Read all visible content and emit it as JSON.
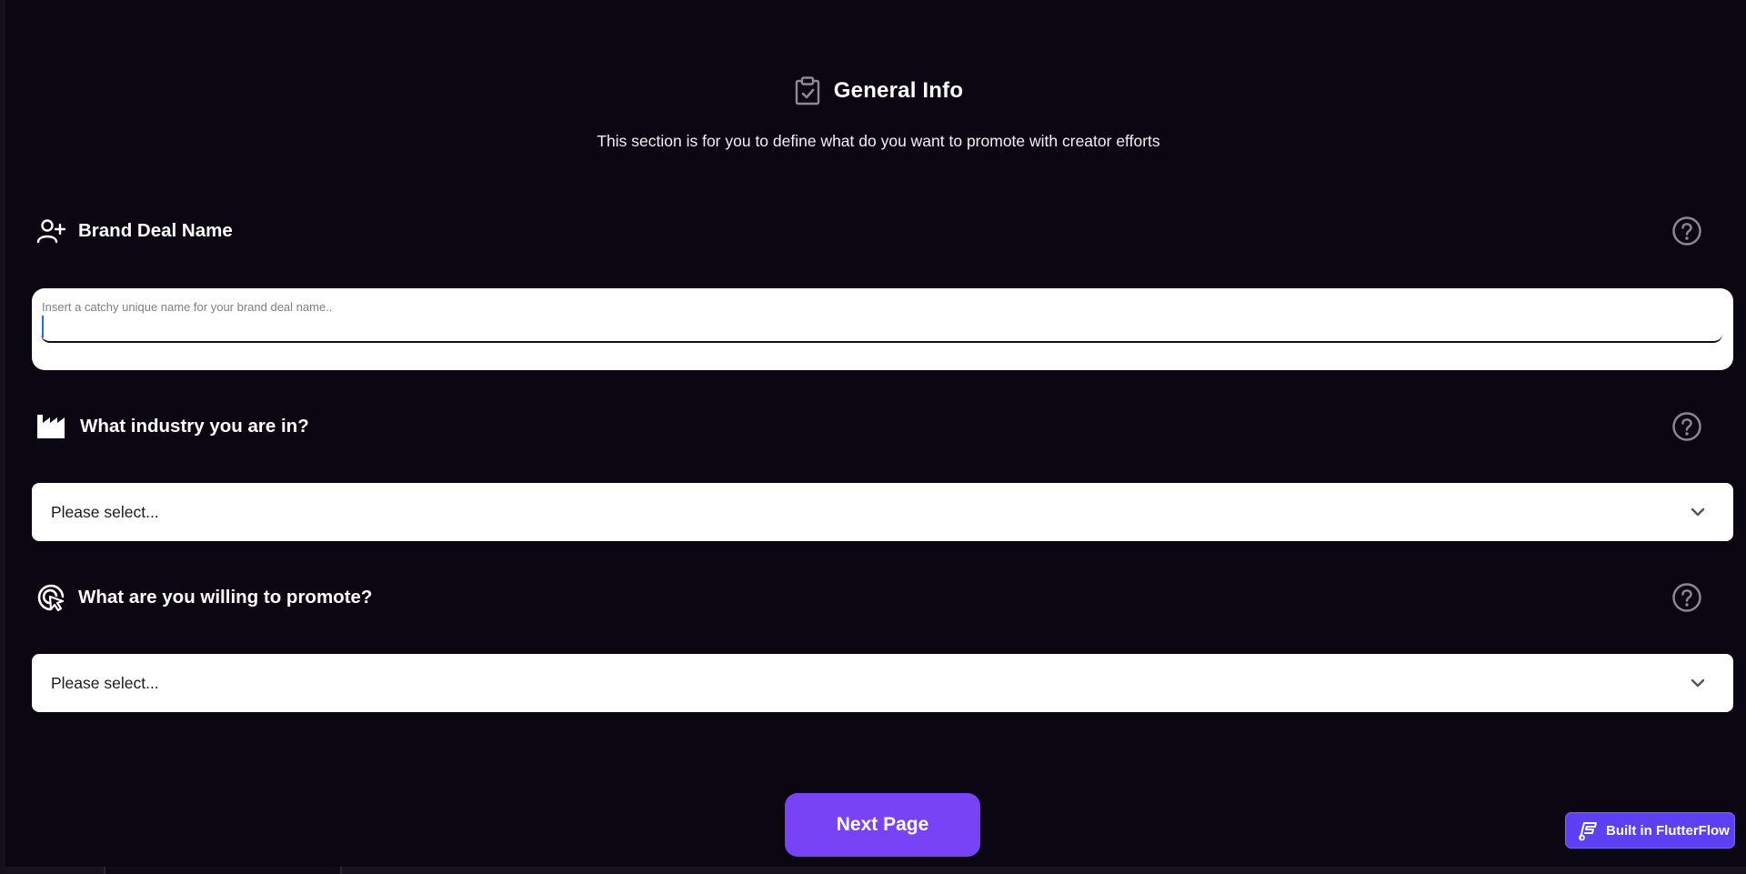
{
  "header": {
    "title": "General Info",
    "subtitle": "This section is for you to define what do you want to promote with creator efforts"
  },
  "sections": {
    "brand_deal": {
      "label": "Brand Deal Name",
      "placeholder": "Insert a catchy unique name for your brand deal name..",
      "value": ""
    },
    "industry": {
      "label": "What industry you are in?",
      "selected": "Please select..."
    },
    "promote": {
      "label": "What are you willing to promote?",
      "selected": "Please select..."
    }
  },
  "actions": {
    "next_label": "Next Page"
  },
  "badge": {
    "label": "Built in FlutterFlow"
  },
  "icons": {
    "header": "clipboard-check-icon",
    "brand_deal": "add-user-icon",
    "industry": "factory-icon",
    "promote": "target-cursor-icon",
    "help": "help-circle-icon",
    "dropdown": "chevron-down-icon",
    "flutterflow": "flutterflow-logo-icon"
  },
  "colors": {
    "background": "#0a0612",
    "accent": "#7743f4",
    "badge": "#5d40f2",
    "surface": "#ffffff"
  }
}
